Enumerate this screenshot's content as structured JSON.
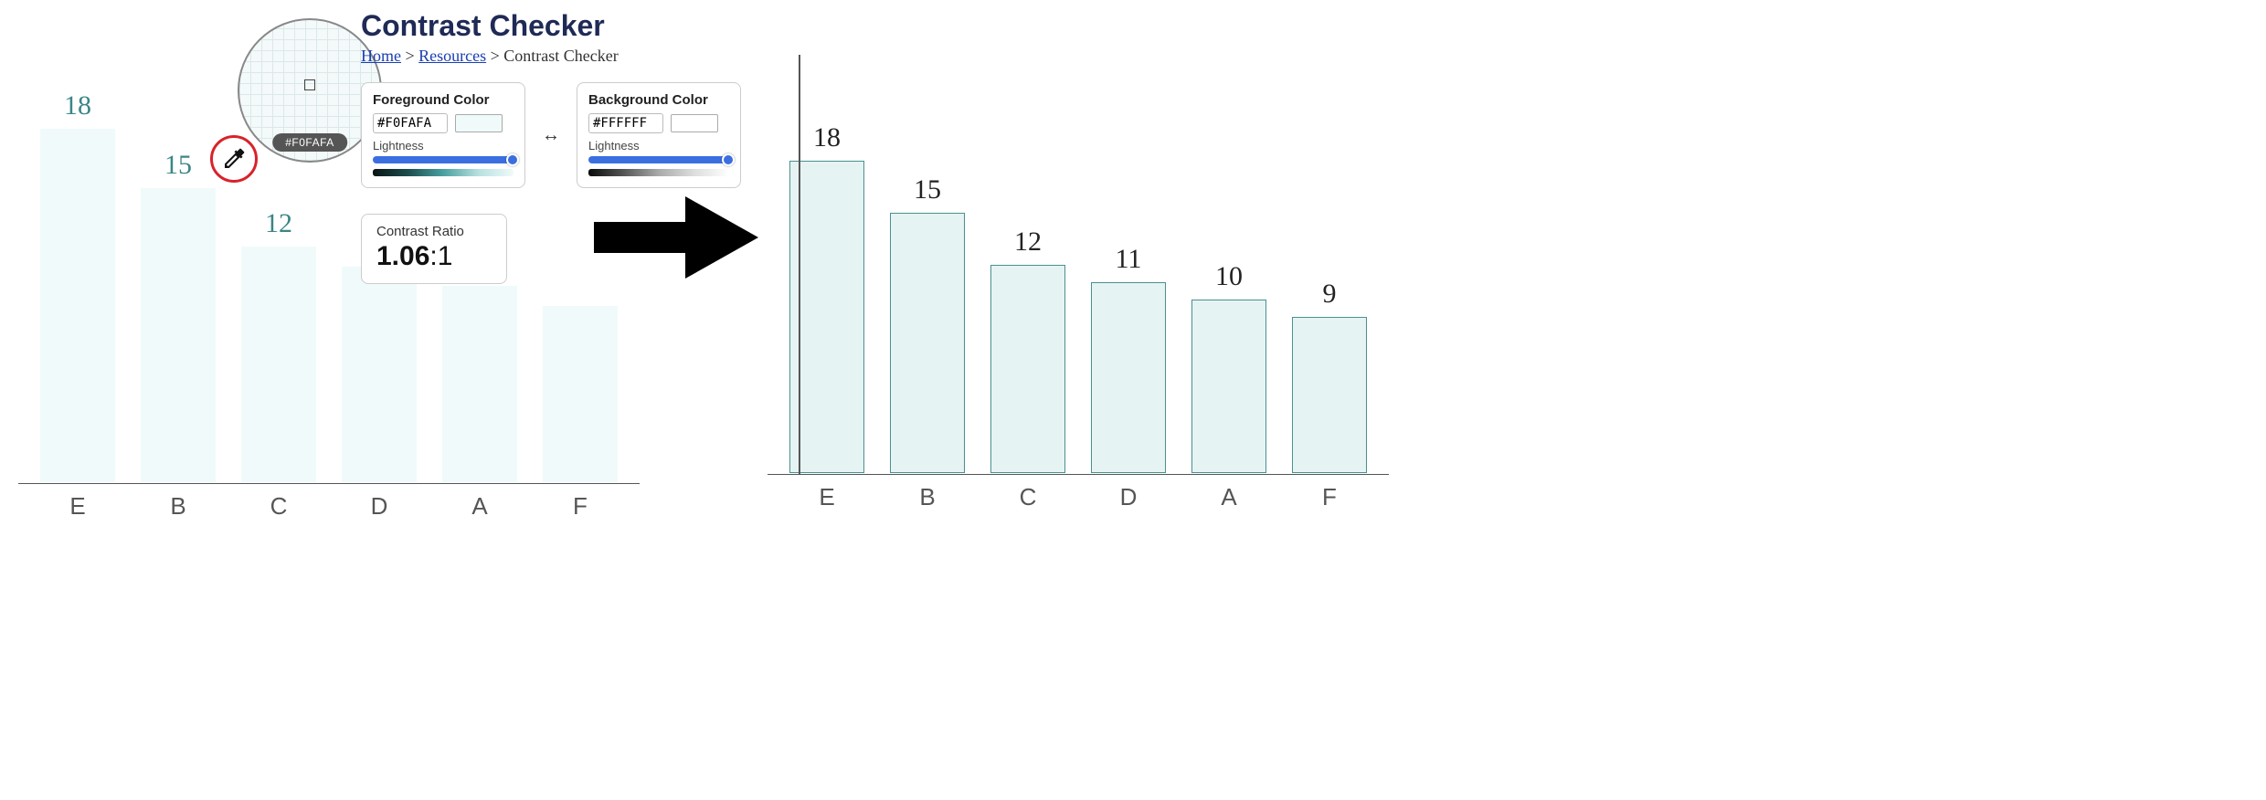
{
  "chart_data": [
    {
      "type": "bar",
      "categories": [
        "E",
        "B",
        "C",
        "D",
        "A",
        "F"
      ],
      "values": [
        18,
        15,
        12,
        11,
        10,
        9
      ],
      "visible_values": [
        18,
        15,
        12,
        null,
        null,
        null
      ],
      "title": "",
      "xlabel": "",
      "ylabel": "",
      "ylim": [
        0,
        20
      ],
      "bar_fill": "#F0FAFA",
      "bar_border": null,
      "value_color": "#3b8686",
      "note": "left chart — low-contrast bars; values for D/A/F obscured by overlay"
    },
    {
      "type": "bar",
      "categories": [
        "E",
        "B",
        "C",
        "D",
        "A",
        "F"
      ],
      "values": [
        18,
        15,
        12,
        11,
        10,
        9
      ],
      "title": "",
      "xlabel": "",
      "ylabel": "",
      "ylim": [
        0,
        20
      ],
      "bar_fill": "#e6f3f3",
      "bar_border": "#4a9090",
      "value_color": "#222222",
      "note": "right chart — bordered bars, improved contrast"
    }
  ],
  "checker": {
    "title": "Contrast Checker",
    "breadcrumb": {
      "home": "Home",
      "sep": ">",
      "resources": "Resources",
      "current": "Contrast Checker"
    },
    "foreground": {
      "label": "Foreground Color",
      "hex": "#F0FAFA",
      "lightness_label": "Lightness"
    },
    "background": {
      "label": "Background Color",
      "hex": "#FFFFFF",
      "lightness_label": "Lightness"
    },
    "swap": "↔",
    "ratio": {
      "label": "Contrast Ratio",
      "value_bold": "1.06",
      "value_suffix": ":1"
    }
  },
  "magnifier": {
    "hex_label": "#F0FAFA"
  }
}
